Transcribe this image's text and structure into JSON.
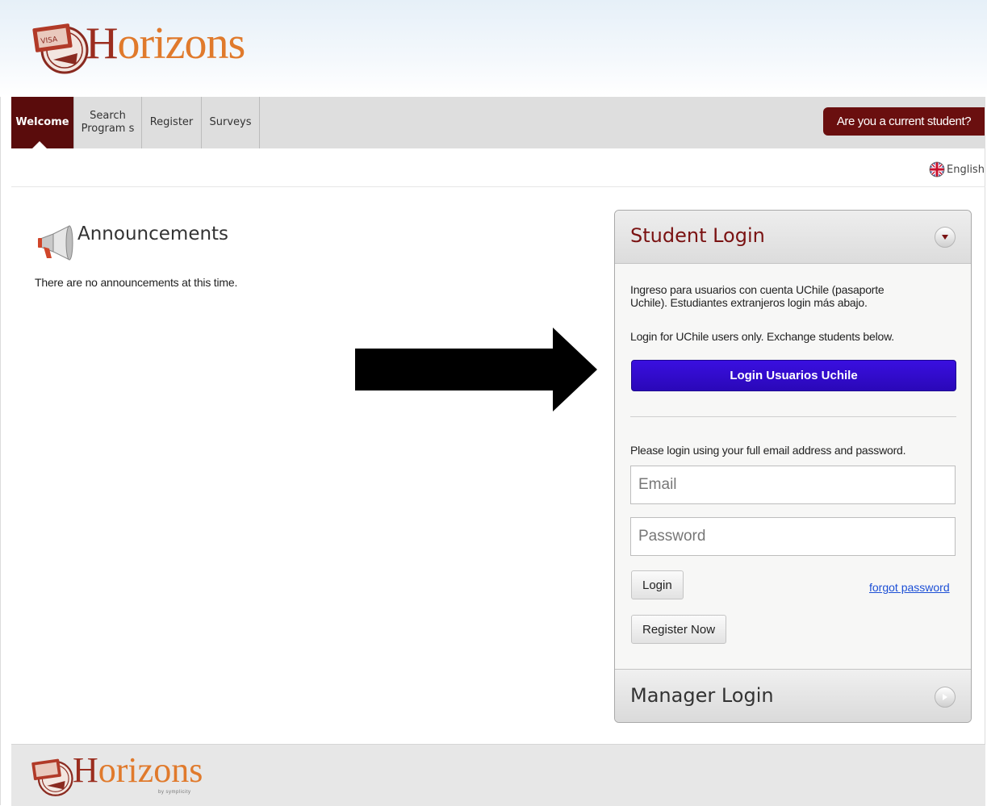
{
  "header": {
    "logo_text_first": "H",
    "logo_text_rest": "orizons"
  },
  "nav": {
    "items": [
      {
        "label": "Welcome"
      },
      {
        "label": "Search Programs",
        "line1": "Search",
        "line2": "Program s"
      },
      {
        "label": "Register"
      },
      {
        "label": "Surveys"
      }
    ],
    "current_student_label": "Are you a current student?"
  },
  "language": {
    "label": "English",
    "icon": "uk-flag-globe-icon"
  },
  "announcements": {
    "title": "Announcements",
    "empty_text": "There are no announcements at this time.",
    "icon": "megaphone-icon"
  },
  "student_login": {
    "title": "Student Login",
    "toggle_icon": "chevron-down-icon",
    "intro_es_line1": "Ingreso para usuarios con cuenta UChile (pasaporte",
    "intro_es_line2": "Uchile). Estudiantes extranjeros login más abajo.",
    "intro_en": "Login for UChile users only. Exchange students below.",
    "uchile_button": "Login Usuarios Uchile",
    "instructions": "Please login using your full email address and password.",
    "email_placeholder": "Email",
    "password_placeholder": "Password",
    "login_button": "Login",
    "forgot_link": "forgot password",
    "register_button": "Register Now"
  },
  "manager_login": {
    "title": "Manager Login",
    "toggle_icon": "chevron-right-icon"
  },
  "footer": {
    "logo_text_first": "H",
    "logo_text_rest": "orizons",
    "sub_text": "by symplicity"
  },
  "colors": {
    "brand_dark_red": "#6a0f0f",
    "logo_orange": "#e07a2c",
    "uchile_blue": "#2a08b8",
    "link_blue": "#1c4fd6"
  }
}
